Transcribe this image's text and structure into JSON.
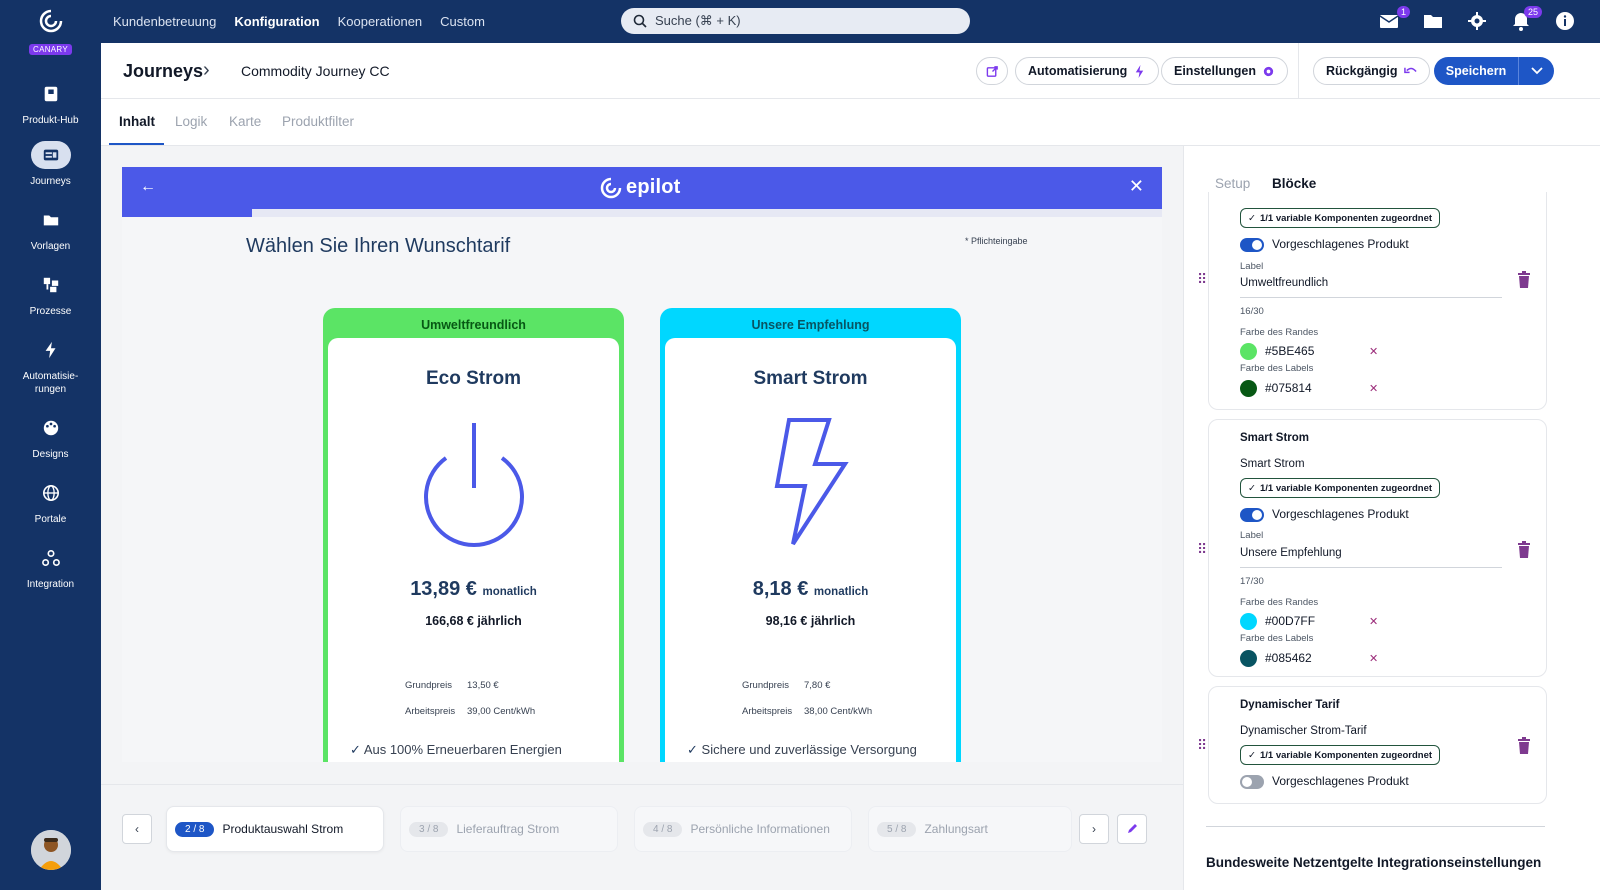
{
  "sidebar": {
    "badge": "CANARY",
    "items": [
      {
        "label": "Produkt-Hub",
        "icon": "product-hub-icon"
      },
      {
        "label": "Journeys",
        "icon": "journeys-icon",
        "active": true
      },
      {
        "label": "Vorlagen",
        "icon": "folder-icon"
      },
      {
        "label": "Prozesse",
        "icon": "processes-icon"
      },
      {
        "label": "Automatisie-\nrungen",
        "icon": "bolt-icon"
      },
      {
        "label": "Designs",
        "icon": "palette-icon"
      },
      {
        "label": "Portale",
        "icon": "globe-icon"
      },
      {
        "label": "Integration",
        "icon": "webhook-icon"
      }
    ]
  },
  "topbar": {
    "nav": [
      "Kundenbetreuung",
      "Konfiguration",
      "Kooperationen",
      "Custom"
    ],
    "active_nav": "Konfiguration",
    "search_placeholder": "Suche (⌘ + K)",
    "mail_badge": "1",
    "notifications_badge": "25"
  },
  "header": {
    "breadcrumb_main": "Journeys",
    "breadcrumb_sub": "Commodity Journey CC",
    "automation_label": "Automatisierung",
    "settings_label": "Einstellungen",
    "undo_label": "Rückgängig",
    "save_label": "Speichern"
  },
  "tabs": [
    "Inhalt",
    "Logik",
    "Karte",
    "Produktfilter"
  ],
  "preview": {
    "logo_text": "epilot",
    "progress": 0.125,
    "title": "Wählen Sie Ihren Wunschtarif",
    "required_note": "* Pflichteingabe",
    "cards": [
      {
        "label": "Umweltfreundlich",
        "border_color": "#5BE465",
        "label_color": "#075814",
        "name": "Eco Strom",
        "illustration": "power-icon",
        "price": "13,89 €",
        "price_unit": "monatlich",
        "yearly": "166,68 € jährlich",
        "grundpreis_label": "Grundpreis",
        "grundpreis": "13,50 €",
        "arbeitspreis_label": "Arbeitspreis",
        "arbeitspreis": "39,00 Cent/kWh",
        "feature": "Aus 100% Erneuerbaren Energien"
      },
      {
        "label": "Unsere Empfehlung",
        "border_color": "#00D7FF",
        "label_color": "#085462",
        "name": "Smart Strom",
        "illustration": "lightning-icon",
        "price": "8,18 €",
        "price_unit": "monatlich",
        "yearly": "98,16 € jährlich",
        "grundpreis_label": "Grundpreis",
        "grundpreis": "7,80 €",
        "arbeitspreis_label": "Arbeitspreis",
        "arbeitspreis": "38,00 Cent/kWh",
        "feature": "Sichere und zuverlässige Versorgung"
      }
    ]
  },
  "steps": [
    {
      "num": "2 / 8",
      "label": "Produktauswahl Strom",
      "active": true
    },
    {
      "num": "3 / 8",
      "label": "Lieferauftrag Strom"
    },
    {
      "num": "4 / 8",
      "label": "Persönliche Informationen"
    },
    {
      "num": "5 / 8",
      "label": "Zahlungsart"
    }
  ],
  "panel": {
    "tabs": [
      "Setup",
      "Blöcke"
    ],
    "chip_text": "1/1 variable Komponenten zugeordnet",
    "toggle_label": "Vorgeschlagenes Produkt",
    "label_caption": "Label",
    "border_caption": "Farbe des Randes",
    "labelcolor_caption": "Farbe des Labels",
    "block1": {
      "label_value": "Umweltfreundlich",
      "counter": "16/30",
      "border_hex": "#5BE465",
      "label_hex": "#075814"
    },
    "block2": {
      "title": "Smart Strom",
      "subtitle": "Smart Strom",
      "label_value": "Unsere Empfehlung",
      "counter": "17/30",
      "border_hex": "#00D7FF",
      "label_hex": "#085462"
    },
    "block3": {
      "title": "Dynamischer Tarif",
      "subtitle": "Dynamischer Strom-Tarif"
    },
    "footer": "Bundesweite Netzentgelte Integrationseinstellungen"
  }
}
